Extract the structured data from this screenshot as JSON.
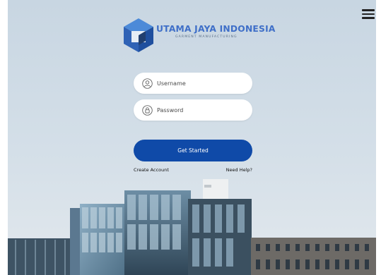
{
  "brand": {
    "name": "UTAMA JAYA INDONESIA",
    "tagline": "GARMENT MANUFACTURING"
  },
  "form": {
    "username_placeholder": "Username",
    "password_placeholder": "Password",
    "submit_label": "Get Started",
    "create_account_label": "Create Account",
    "help_label": "Need Help?"
  },
  "icons": {
    "menu": "hamburger-menu-icon",
    "logo": "cube-logo",
    "username": "user-icon",
    "password": "lock-icon"
  },
  "colors": {
    "brand_blue": "#3f6fc8",
    "button": "#0f4aa8",
    "sky": "#c9d7e3"
  }
}
